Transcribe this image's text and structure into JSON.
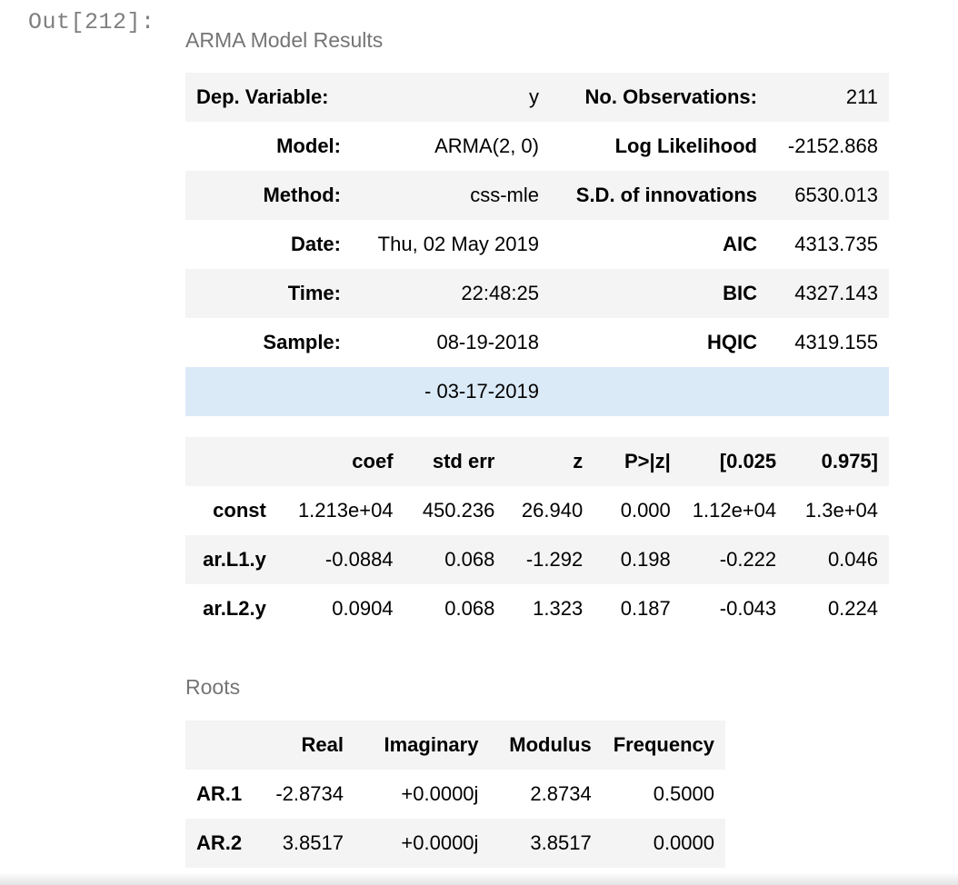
{
  "cell": {
    "prompt": "Out[212]:"
  },
  "model_caption": "ARMA Model Results",
  "model_table": {
    "rows": [
      {
        "l1": "Dep. Variable:",
        "v1": "y",
        "l2": "No. Observations:",
        "v2": "211"
      },
      {
        "l1": "Model:",
        "v1": "ARMA(2, 0)",
        "l2": "Log Likelihood",
        "v2": "-2152.868"
      },
      {
        "l1": "Method:",
        "v1": "css-mle",
        "l2": "S.D. of innovations",
        "v2": "6530.013"
      },
      {
        "l1": "Date:",
        "v1": "Thu, 02 May 2019",
        "l2": "AIC",
        "v2": "4313.735"
      },
      {
        "l1": "Time:",
        "v1": "22:48:25",
        "l2": "BIC",
        "v2": "4327.143"
      },
      {
        "l1": "Sample:",
        "v1": "08-19-2018",
        "l2": "HQIC",
        "v2": "4319.155"
      },
      {
        "l1": "",
        "v1": "- 03-17-2019",
        "l2": "",
        "v2": ""
      }
    ]
  },
  "coef_table": {
    "headers": [
      "",
      "coef",
      "std err",
      "z",
      "P>|z|",
      "[0.025",
      "0.975]"
    ],
    "rows": [
      [
        "const",
        "1.213e+04",
        "450.236",
        "26.940",
        "0.000",
        "1.12e+04",
        "1.3e+04"
      ],
      [
        "ar.L1.y",
        "-0.0884",
        "0.068",
        "-1.292",
        "0.198",
        "-0.222",
        "0.046"
      ],
      [
        "ar.L2.y",
        "0.0904",
        "0.068",
        "1.323",
        "0.187",
        "-0.043",
        "0.224"
      ]
    ]
  },
  "roots_caption": "Roots",
  "roots_table": {
    "headers": [
      "",
      "Real",
      "Imaginary",
      "Modulus",
      "Frequency"
    ],
    "rows": [
      [
        "AR.1",
        "-2.8734",
        "+0.0000j",
        "2.8734",
        "0.5000"
      ],
      [
        "AR.2",
        "3.8517",
        "+0.0000j",
        "3.8517",
        "0.0000"
      ]
    ]
  },
  "colors": {
    "row_shade": "#f4f4f4",
    "row_highlight": "#dbeaf7",
    "prompt_text": "#7f7f7f",
    "caption_text": "#757575"
  }
}
